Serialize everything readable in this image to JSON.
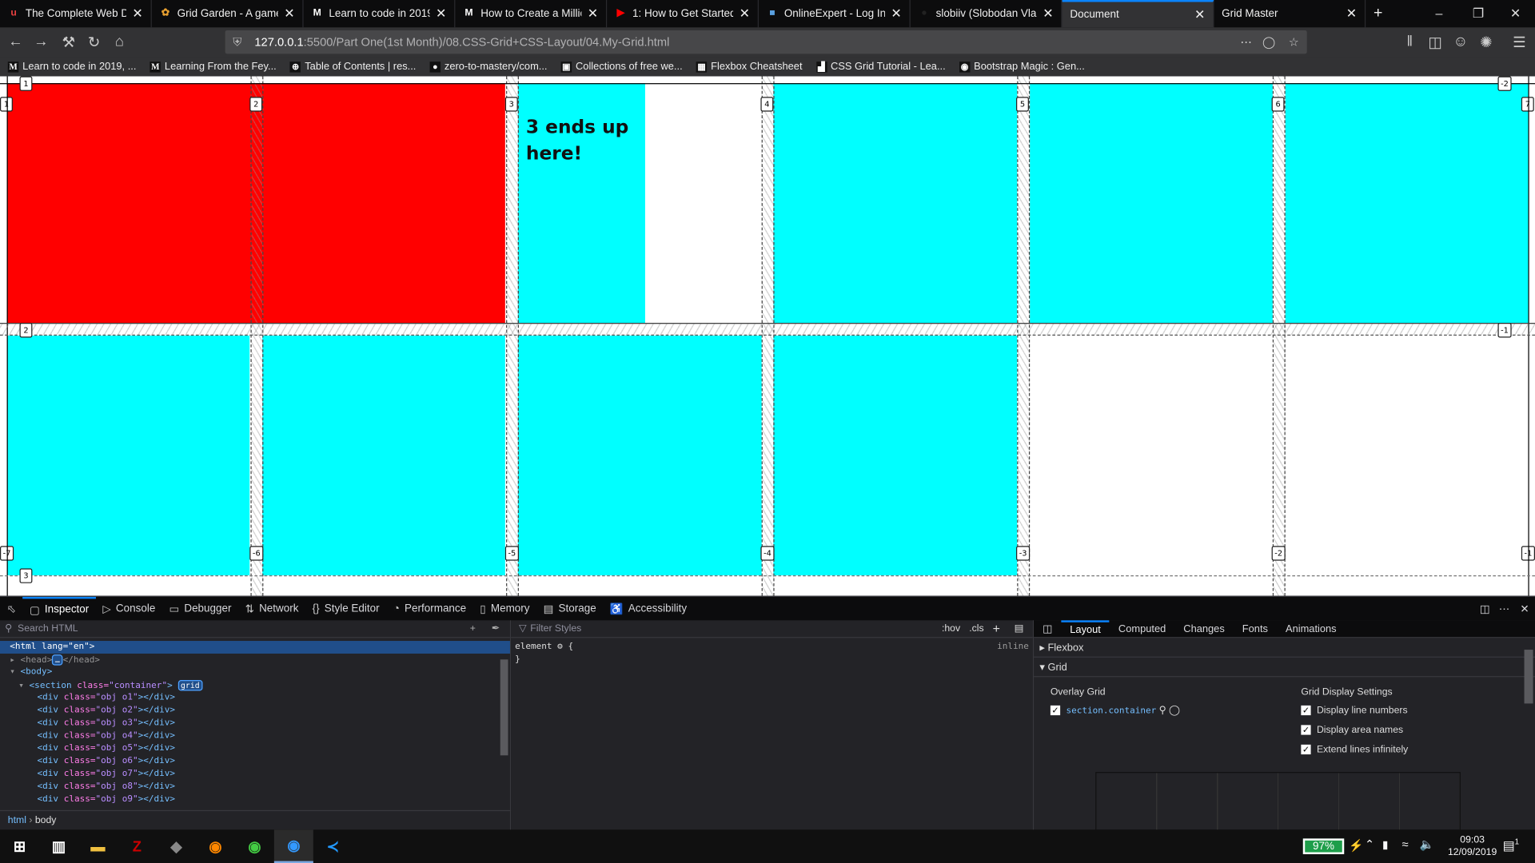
{
  "browser": {
    "tabs": [
      {
        "title": "The Complete Web Deve",
        "icon": "udemy-icon"
      },
      {
        "title": "Grid Garden - A game fo",
        "icon": "grid-garden-icon"
      },
      {
        "title": "Learn to code in 2019, ge",
        "icon": "medium-icon"
      },
      {
        "title": "How to Create a Million-",
        "icon": "medium-icon"
      },
      {
        "title": "1: How to Get Started Wi",
        "icon": "youtube-icon"
      },
      {
        "title": "OnlineExpert - Log In",
        "icon": "onlineexpert-icon"
      },
      {
        "title": "slobiiv (Slobodan Vlaic)",
        "icon": "github-icon"
      },
      {
        "title": "Document",
        "icon": "",
        "active": true
      },
      {
        "title": "Grid Master",
        "icon": ""
      }
    ],
    "url_host": "127.0.0.1",
    "url_rest": ":5500/Part One(1st Month)/08.CSS-Grid+CSS-Layout/04.My-Grid.html",
    "bookmarks": [
      {
        "label": "Learn to code in 2019, ...",
        "icon": "M"
      },
      {
        "label": "Learning From the Fey...",
        "icon": "M"
      },
      {
        "label": "Table of Contents | res...",
        "icon": "⊕"
      },
      {
        "label": "zero-to-mastery/com...",
        "icon": "●"
      },
      {
        "label": "Collections of free we...",
        "icon": "▣"
      },
      {
        "label": "Flexbox Cheatsheet",
        "icon": "▦"
      },
      {
        "label": "CSS Grid Tutorial - Lea...",
        "icon": "▟"
      },
      {
        "label": "Bootstrap Magic : Gen...",
        "icon": "◉"
      }
    ]
  },
  "page": {
    "cells": [
      {
        "class": "o1",
        "text": "",
        "color": "#ff0000"
      },
      {
        "class": "o2",
        "text": "3 ends up here!",
        "color": "#00ffff"
      },
      {
        "class": "o3",
        "text": "",
        "color": "#00ffff"
      },
      {
        "class": "o4",
        "text": "",
        "color": "#00ffff"
      },
      {
        "class": "o5",
        "text": "",
        "color": "#00ffff"
      },
      {
        "class": "o6",
        "text": "",
        "color": "#00ffff"
      },
      {
        "class": "o7",
        "text": "",
        "color": "#00ffff"
      },
      {
        "class": "o8",
        "text": "",
        "color": "#00ffff"
      },
      {
        "class": "o9",
        "text": "",
        "color": "#00ffff"
      }
    ],
    "col_lines_top": [
      "1",
      "2",
      "3",
      "4",
      "5",
      "6",
      "7"
    ],
    "col_lines_bottom": [
      "-7",
      "-6",
      "-5",
      "-4",
      "-3",
      "-2",
      "-1"
    ],
    "row_lines_left": [
      "1",
      "2",
      "3"
    ],
    "row_lines_right": [
      "-2",
      "-1"
    ]
  },
  "devtools": {
    "tabs": [
      {
        "label": "Inspector",
        "icon": "▢",
        "active": true
      },
      {
        "label": "Console",
        "icon": "▷"
      },
      {
        "label": "Debugger",
        "icon": "▭"
      },
      {
        "label": "Network",
        "icon": "⇅"
      },
      {
        "label": "Style Editor",
        "icon": "{}"
      },
      {
        "label": "Performance",
        "icon": "◔"
      },
      {
        "label": "Memory",
        "icon": "▯"
      },
      {
        "label": "Storage",
        "icon": "▤"
      },
      {
        "label": "Accessibility",
        "icon": "♿"
      }
    ],
    "search_placeholder": "Search HTML",
    "markup": {
      "html": "<html lang=\"en\">",
      "head_open": "<head>",
      "head_close": "</head>",
      "body": "<body>",
      "section_tag": "<section ",
      "section_attr": "class=",
      "section_val": "\"container\"",
      "section_end": ">",
      "grid_badge": "grid",
      "divs": [
        "\"obj o1\"",
        "\"obj o2\"",
        "\"obj o3\"",
        "\"obj o4\"",
        "\"obj o5\"",
        "\"obj o6\"",
        "\"obj o7\"",
        "\"obj o8\"",
        "\"obj o9\""
      ],
      "div_open": "<div ",
      "div_attr": "class=",
      "div_close": "></div>"
    },
    "breadcrumb": [
      "html",
      "body"
    ],
    "rules": {
      "filter_placeholder": "Filter Styles",
      "hov": ":hov",
      "cls": ".cls",
      "element_rule": "element",
      "open_brace": "{",
      "close_brace": "}",
      "inline": "inline"
    },
    "layout": {
      "tabs": [
        "Layout",
        "Computed",
        "Changes",
        "Fonts",
        "Animations"
      ],
      "flexbox": "Flexbox",
      "grid": "Grid",
      "overlay_title": "Overlay Grid",
      "overlay_item": "section.container",
      "settings_title": "Grid Display Settings",
      "settings": [
        {
          "label": "Display line numbers",
          "checked": true
        },
        {
          "label": "Display area names",
          "checked": true
        },
        {
          "label": "Extend lines infinitely",
          "checked": true
        }
      ]
    }
  },
  "taskbar": {
    "apps": [
      "windows-start-icon",
      "task-view-icon",
      "file-explorer-icon",
      "filezilla-icon",
      "git-icon",
      "firefox-icon",
      "chrome-icon",
      "firefox-dev-icon",
      "vscode-icon"
    ],
    "battery": "97%",
    "time": "09:03",
    "date": "12/09/2019",
    "notifications": "1"
  }
}
